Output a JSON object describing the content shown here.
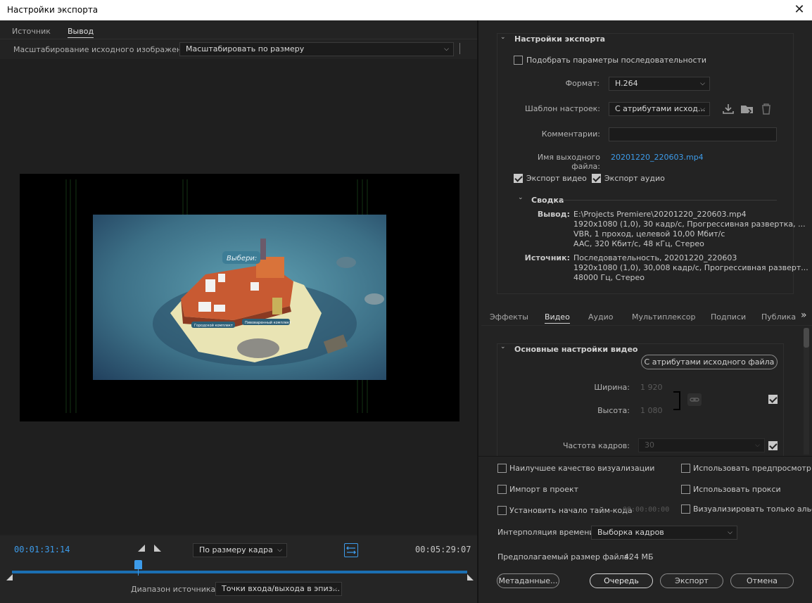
{
  "window": {
    "title": "Настройки экспорта",
    "close_glyph": "✕"
  },
  "left": {
    "tabs": [
      "Источник",
      "Вывод"
    ],
    "scale_label": "Масштабирование исходного изображения:",
    "scale_value": "Масштабировать по размеру",
    "video_labels": {
      "bubble": "Выбери:",
      "tag1": "Городской комплект",
      "tag2": "Пивоваренный комплект"
    },
    "transport": {
      "current_time": "00:01:31:14",
      "fit_value": "По размеру кадра",
      "end_time": "00:05:29:07",
      "source_range_label": "Диапазон источника:",
      "source_range_value": "Точки входа/выхода в эпиз..."
    }
  },
  "export_settings": {
    "header": "Настройки экспорта",
    "match_sequence": "Подобрать параметры последовательности",
    "format_label": "Формат:",
    "format_value": "H.264",
    "preset_label": "Шаблон настроек:",
    "preset_value": "С атрибутами исход...",
    "comments_label": "Комментарии:",
    "comments_value": "",
    "output_name_label": "Имя выходного файла:",
    "output_name_value": "20201220_220603.mp4",
    "export_video": "Экспорт видео",
    "export_audio": "Экспорт аудио",
    "summary_header": "Сводка",
    "output_label": "Вывод:",
    "output_lines": [
      "E:\\Projects Premiere\\20201220_220603.mp4",
      "1920x1080 (1,0), 30 кадр/с, Прогрессивная развертка, ...",
      "VBR, 1 проход, целевой 10,00 Мбит/с",
      "AAC, 320 Кбит/с, 48 кГц, Стерео"
    ],
    "source_label": "Источник:",
    "source_lines": [
      "Последовательность, 20201220_220603",
      "1920x1080 (1,0), 30,008 кадр/с, Прогрессивная разверт...",
      "48000 Гц, Стерео"
    ]
  },
  "subtabs": [
    "Эффекты",
    "Видео",
    "Аудио",
    "Мультиплексор",
    "Подписи",
    "Публикац"
  ],
  "video_settings": {
    "header": "Основные настройки видео",
    "match_source_button": "С атрибутами исходного файла",
    "width_label": "Ширина:",
    "width_value": "1 920",
    "height_label": "Высота:",
    "height_value": "1 080",
    "framerate_label": "Частота кадров:",
    "framerate_value": "30"
  },
  "options": {
    "max_render_quality": "Наилучшее качество визуализации",
    "use_previews": "Использовать предпросмотр",
    "import_into_project": "Импорт в проект",
    "use_proxies": "Использовать прокси",
    "set_start_timecode": "Установить начало тайм-кода",
    "start_timecode_value": "00:00:00:00",
    "render_alpha_only": "Визуализировать только альфа-",
    "time_interpolation_label": "Интерполяция времени:",
    "time_interpolation_value": "Выборка кадров",
    "estimated_size_label": "Предполагаемый размер файла:",
    "estimated_size_value": "424 МБ"
  },
  "buttons": {
    "metadata": "Метаданные...",
    "queue": "Очередь",
    "export": "Экспорт",
    "cancel": "Отмена"
  },
  "colors": {
    "accent": "#3d9be9",
    "background": "#232323"
  }
}
